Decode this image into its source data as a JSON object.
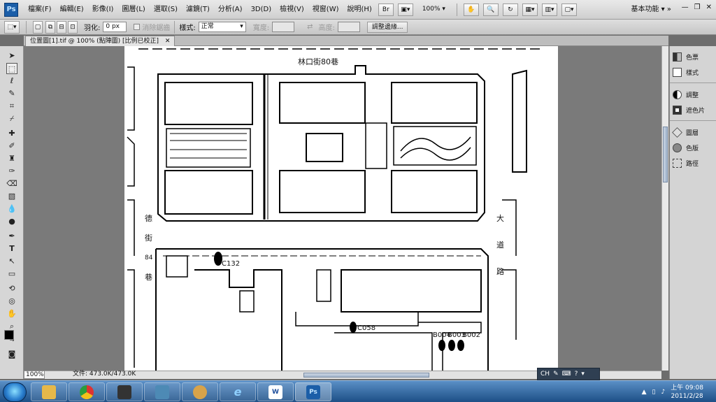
{
  "menu": {
    "items": [
      "檔案(F)",
      "編輯(E)",
      "影像(I)",
      "圖層(L)",
      "選取(S)",
      "濾鏡(T)",
      "分析(A)",
      "3D(D)",
      "檢視(V)",
      "視窗(W)",
      "說明(H)"
    ],
    "bridge_label": "Br",
    "zoom": "100%",
    "workspace": "基本功能",
    "ps_logo": "Ps"
  },
  "options": {
    "feather_label": "羽化:",
    "feather_value": "0 px",
    "antialias_label": "消除鋸齒",
    "style_label": "樣式:",
    "style_value": "正常",
    "width_label": "寬度:",
    "height_label": "高度:",
    "refine_button": "調整邊緣..."
  },
  "document": {
    "tab_title": "位置圖[1].tif @ 100% (點陣圖) [比例已校正]",
    "map_labels": {
      "street_top": "林口街80巷",
      "side_street": [
        "德",
        "街",
        "84",
        "巷"
      ],
      "avenue": [
        "大",
        "道",
        "路"
      ],
      "markers": [
        "C132",
        "C058",
        "B004",
        "B003",
        "B002"
      ]
    }
  },
  "status": {
    "zoom": "100%",
    "doc_size": "文件: 473.0K/473.0K"
  },
  "panels": {
    "items": [
      "色票",
      "樣式",
      "調整",
      "遮色片",
      "圖層",
      "色版",
      "路徑"
    ]
  },
  "langbar": {
    "lang": "CH"
  },
  "taskbar": {
    "time": "上午 09:08",
    "date": "2011/2/28",
    "ps_label": "Ps",
    "word_label": "W"
  }
}
